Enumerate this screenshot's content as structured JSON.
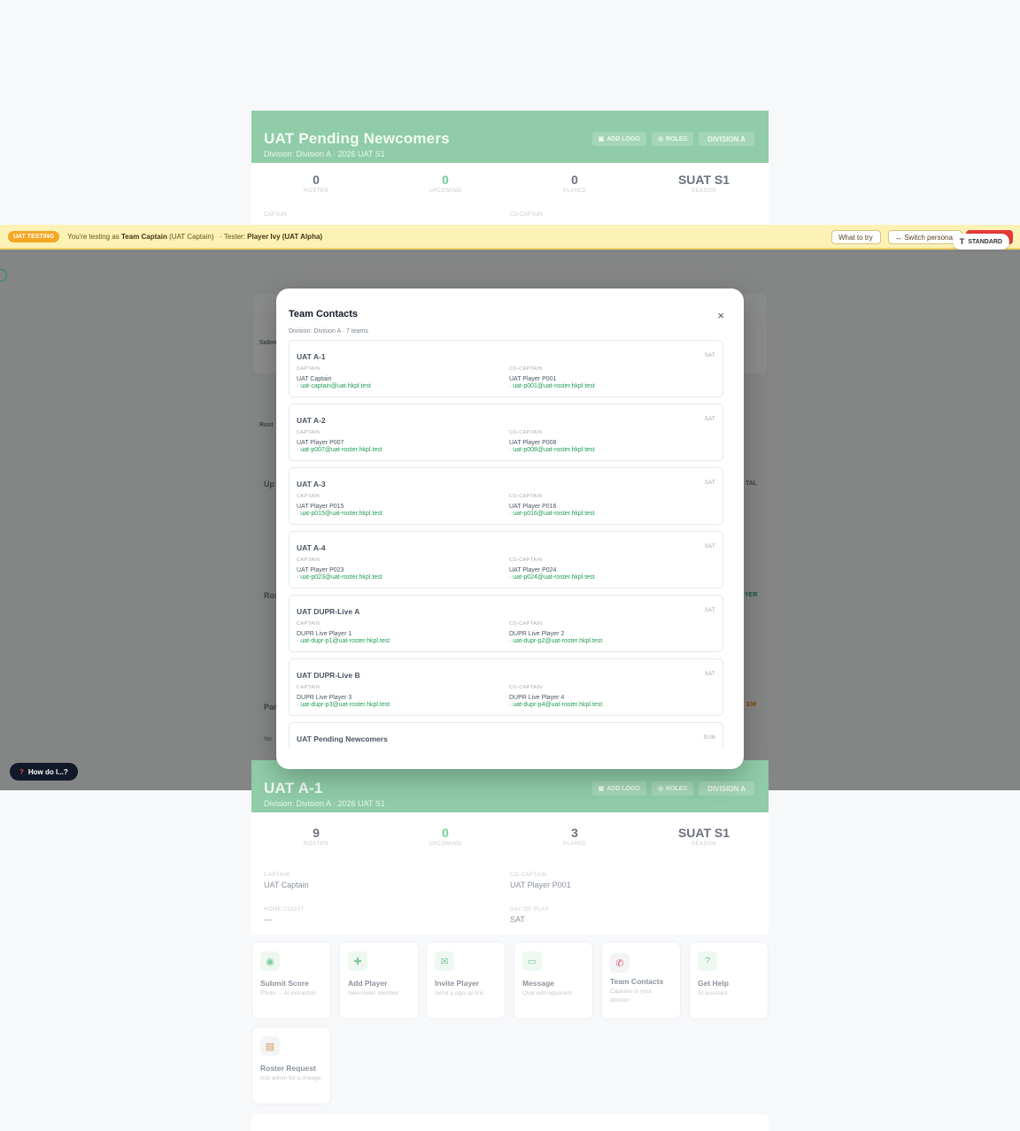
{
  "bg_card_top": {
    "name": "UAT Pending Newcomers",
    "sub": "Division: Division A · 2026 UAT S1",
    "buttons": [
      "ADD LOGO",
      "ROLES",
      "DIVISION A"
    ],
    "stats": [
      {
        "value": "0",
        "label": "ROSTER"
      },
      {
        "value": "0",
        "label": "UPCOMING"
      },
      {
        "value": "0",
        "label": "PLAYED"
      },
      {
        "value": "SUAT S1",
        "label": "SEASON"
      }
    ],
    "captain_label": "CAPTAIN",
    "cocaptain_label": "CO-CAPTAIN"
  },
  "uat_bar": {
    "badge": "UAT TESTING",
    "testing_prefix": "You're testing as",
    "role": "Team Captain",
    "role_paren": "(UAT Captain)",
    "tester_prefix": "· Tester:",
    "tester": "Player Ivy (UAT Alpha)",
    "what_to_try": "What to try",
    "switch_persona": "↔ Switch persona",
    "standard": "STANDARD"
  },
  "ghost": {
    "submit": "Submi",
    "roster": "Rost",
    "upcoming": "Up",
    "total": "TAL",
    "ros": "Ros",
    "player": "YER",
    "par": "Par",
    "new": "EW",
    "no": "No"
  },
  "modal": {
    "title": "Team Contacts",
    "close": "×",
    "subtitle": "Division: Division A · 7 teams",
    "teams": [
      {
        "name": "UAT A-1",
        "day": "SAT",
        "captain_label": "CAPTAIN",
        "captain": "UAT Captain",
        "captain_email": "· uat-captain@uat.hkpl.test",
        "cocaptain_label": "CO-CAPTAIN",
        "cocaptain": "UAT Player P001",
        "cocaptain_email": "· uat-p001@uat-roster.hkpl.test"
      },
      {
        "name": "UAT A-2",
        "day": "SAT",
        "captain_label": "CAPTAIN",
        "captain": "UAT Player P007",
        "captain_email": "· uat-p007@uat-roster.hkpl.test",
        "cocaptain_label": "CO-CAPTAIN",
        "cocaptain": "UAT Player P008",
        "cocaptain_email": "· uat-p008@uat-roster.hkpl.test"
      },
      {
        "name": "UAT A-3",
        "day": "SAT",
        "captain_label": "CAPTAIN",
        "captain": "UAT Player P015",
        "captain_email": "· uat-p015@uat-roster.hkpl.test",
        "cocaptain_label": "CO-CAPTAIN",
        "cocaptain": "UAT Player P016",
        "cocaptain_email": "· uat-p016@uat-roster.hkpl.test"
      },
      {
        "name": "UAT A-4",
        "day": "SAT",
        "captain_label": "CAPTAIN",
        "captain": "UAT Player P023",
        "captain_email": "· uat-p023@uat-roster.hkpl.test",
        "cocaptain_label": "CO-CAPTAIN",
        "cocaptain": "UAT Player P024",
        "cocaptain_email": "· uat-p024@uat-roster.hkpl.test"
      },
      {
        "name": "UAT DUPR-Live A",
        "day": "SAT",
        "captain_label": "CAPTAIN",
        "captain": "DUPR Live Player 1",
        "captain_email": "· uat-dupr-p1@uat-roster.hkpl.test",
        "cocaptain_label": "CO-CAPTAIN",
        "cocaptain": "DUPR Live Player 2",
        "cocaptain_email": "· uat-dupr-p2@uat-roster.hkpl.test"
      },
      {
        "name": "UAT DUPR-Live B",
        "day": "SAT",
        "captain_label": "CAPTAIN",
        "captain": "DUPR Live Player 3",
        "captain_email": "· uat-dupr-p3@uat-roster.hkpl.test",
        "cocaptain_label": "CO-CAPTAIN",
        "cocaptain": "DUPR Live Player 4",
        "cocaptain_email": "· uat-dupr-p4@uat-roster.hkpl.test"
      },
      {
        "name": "UAT Pending Newcomers",
        "day": "SUN"
      }
    ]
  },
  "help_button": {
    "label": "How do I...?"
  },
  "bg_card_bottom": {
    "name": "UAT A-1",
    "sub": "Division: Division A · 2026 UAT S1",
    "buttons": [
      "ADD LOGO",
      "ROLES",
      "DIVISION A"
    ],
    "stats": [
      {
        "value": "9",
        "label": "ROSTER"
      },
      {
        "value": "0",
        "label": "UPCOMING"
      },
      {
        "value": "3",
        "label": "PLAYED"
      },
      {
        "value": "SUAT S1",
        "label": "SEASON"
      }
    ],
    "info": [
      {
        "label": "CAPTAIN",
        "value": "UAT Captain"
      },
      {
        "label": "CO-CAPTAIN",
        "value": "UAT Player P001"
      },
      {
        "label": "HOME COURT",
        "value": "—"
      },
      {
        "label": "DAY OF PLAY",
        "value": "SAT"
      }
    ],
    "actions": [
      {
        "icon": "camera-icon",
        "title": "Submit Score",
        "desc": "Photo → AI extraction"
      },
      {
        "icon": "user-plus-icon",
        "title": "Add Player",
        "desc": "New roster member"
      },
      {
        "icon": "mail-icon",
        "title": "Invite Player",
        "desc": "Send a sign-up link"
      },
      {
        "icon": "message-icon",
        "title": "Message",
        "desc": "Chat with opponent"
      },
      {
        "icon": "phone-icon",
        "title": "Team Contacts",
        "desc": "Captains in your division"
      },
      {
        "icon": "help-circle-icon",
        "title": "Get Help",
        "desc": "AI assistant"
      },
      {
        "icon": "clipboard-icon",
        "title": "Roster Request",
        "desc": "Ask admin for a change"
      }
    ]
  }
}
